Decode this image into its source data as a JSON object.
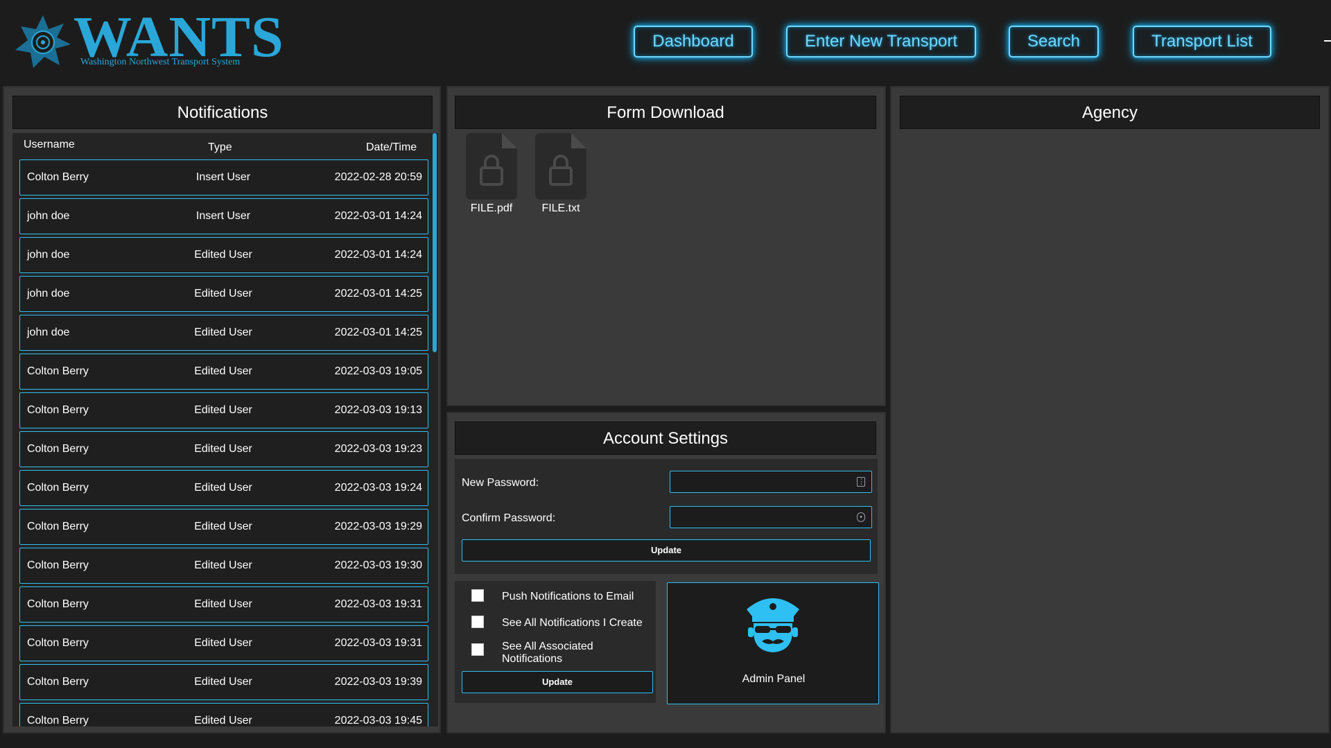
{
  "header": {
    "logo_title": "WANTS",
    "logo_subtitle": "Washington Northwest Transport System",
    "nav": [
      {
        "label": "Dashboard"
      },
      {
        "label": "Enter New Transport"
      },
      {
        "label": "Search"
      },
      {
        "label": "Transport List"
      }
    ]
  },
  "notifications": {
    "title": "Notifications",
    "columns": {
      "username": "Username",
      "type": "Type",
      "datetime": "Date/Time"
    },
    "rows": [
      {
        "username": "Colton Berry",
        "type": "Insert User",
        "datetime": "2022-02-28 20:59"
      },
      {
        "username": "john doe",
        "type": "Insert User",
        "datetime": "2022-03-01 14:24"
      },
      {
        "username": "john doe",
        "type": "Edited User",
        "datetime": "2022-03-01 14:24"
      },
      {
        "username": "john doe",
        "type": "Edited User",
        "datetime": "2022-03-01 14:25"
      },
      {
        "username": "john doe",
        "type": "Edited User",
        "datetime": "2022-03-01 14:25"
      },
      {
        "username": "Colton Berry",
        "type": "Edited User",
        "datetime": "2022-03-03 19:05"
      },
      {
        "username": "Colton Berry",
        "type": "Edited User",
        "datetime": "2022-03-03 19:13"
      },
      {
        "username": "Colton Berry",
        "type": "Edited User",
        "datetime": "2022-03-03 19:23"
      },
      {
        "username": "Colton Berry",
        "type": "Edited User",
        "datetime": "2022-03-03 19:24"
      },
      {
        "username": "Colton Berry",
        "type": "Edited User",
        "datetime": "2022-03-03 19:29"
      },
      {
        "username": "Colton Berry",
        "type": "Edited User",
        "datetime": "2022-03-03 19:30"
      },
      {
        "username": "Colton Berry",
        "type": "Edited User",
        "datetime": "2022-03-03 19:31"
      },
      {
        "username": "Colton Berry",
        "type": "Edited User",
        "datetime": "2022-03-03 19:31"
      },
      {
        "username": "Colton Berry",
        "type": "Edited User",
        "datetime": "2022-03-03 19:39"
      },
      {
        "username": "Colton Berry",
        "type": "Edited User",
        "datetime": "2022-03-03 19:45"
      }
    ]
  },
  "form_download": {
    "title": "Form Download",
    "files": [
      {
        "name": "FILE.pdf",
        "icon": "locked-file-icon"
      },
      {
        "name": "FILE.txt",
        "icon": "locked-file-icon"
      }
    ]
  },
  "account_settings": {
    "title": "Account Settings",
    "new_password_label": "New Password:",
    "confirm_password_label": "Confirm Password:",
    "new_password_value": "",
    "confirm_password_value": "",
    "update_label": "Update",
    "checkboxes": [
      {
        "label": "Push Notifications to Email",
        "checked": false
      },
      {
        "label": "See All Notifications I Create",
        "checked": false
      },
      {
        "label": "See All Associated Notifications",
        "checked": false
      }
    ],
    "checkbox_update_label": "Update",
    "admin_label": "Admin Panel"
  },
  "agency": {
    "title": "Agency"
  },
  "colors": {
    "accent": "#2ec0f2",
    "nav_glow": "#6fd8ff",
    "panel": "#3a3a3a",
    "background": "#1c1c1c"
  }
}
